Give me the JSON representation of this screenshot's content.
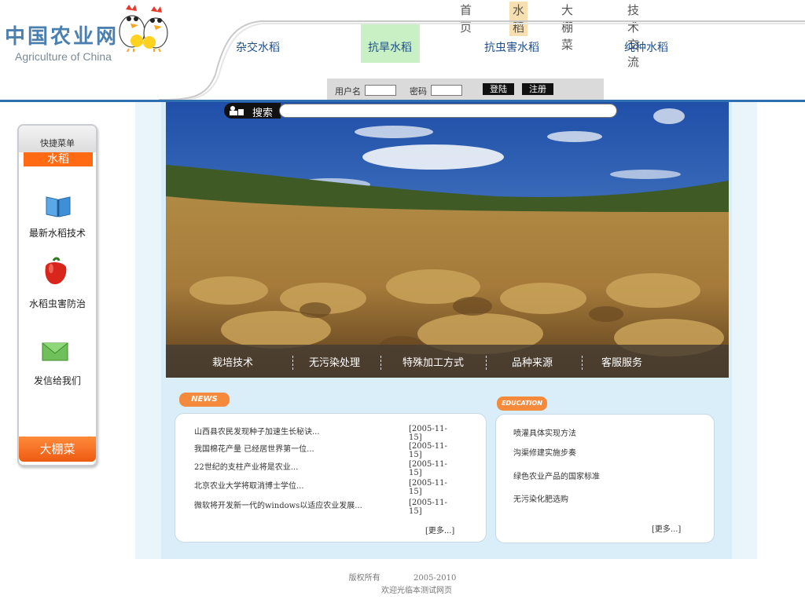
{
  "logo": {
    "cn": "中国农业网",
    "en": "Agriculture of China"
  },
  "top_nav": {
    "items": [
      "首页",
      "水稻",
      "大棚菜",
      "技术交流"
    ],
    "active": "水稻"
  },
  "sub_nav": {
    "items": [
      "杂交水稻",
      "抗旱水稻",
      "抗虫害水稻",
      "纯种水稻"
    ],
    "active": "抗旱水稻"
  },
  "login": {
    "username_label": "用户名",
    "password_label": "密码",
    "login_button": "登陆",
    "register_button": "注册"
  },
  "search": {
    "label": "搜索"
  },
  "left_menu": {
    "title": "快捷菜单",
    "category": "水稻",
    "items": [
      {
        "label": "最新水稻技术",
        "icon": "book-icon"
      },
      {
        "label": "水稻虫害防治",
        "icon": "pepper-icon"
      },
      {
        "label": "发信给我们",
        "icon": "envelope-icon"
      }
    ],
    "bottom": "大棚菜"
  },
  "hero_menu": {
    "items": [
      "栽培技术",
      "无污染处理",
      "特殊加工方式",
      "品种来源",
      "客服服务"
    ]
  },
  "news": {
    "tag": "NEWS",
    "items": [
      {
        "title": "山西县农民发现种子加速生长秘诀...",
        "date": "[2005-11-15]"
      },
      {
        "title": "我国棉花产量 已经居世界第一位...",
        "date": "[2005-11-15]"
      },
      {
        "title": "22世纪的支柱产业将是农业...",
        "date": "[2005-11-15]"
      },
      {
        "title": "北京农业大学将取消博士学位...",
        "date": "[2005-11-15]"
      },
      {
        "title": "微软将开发新一代的windows以适应农业发展...",
        "date": "[2005-11-15]"
      }
    ],
    "more": "[更多...]"
  },
  "education": {
    "tag": "EDUCATION",
    "items": [
      "喷灌具体实现方法",
      "沟渠修建实施步奏",
      "绿色农业产品的国家标准",
      "无污染化肥选购"
    ],
    "more": "[更多...]"
  },
  "footer": {
    "copyright": "版权所有",
    "years": "2005-2010",
    "welcome": "欢迎光临本测试网页"
  },
  "colors": {
    "accent_orange": "#f58a3c",
    "nav_blue": "#1e4e8a",
    "header_line": "#2f6fb0",
    "active_green": "#c8f0c4"
  }
}
